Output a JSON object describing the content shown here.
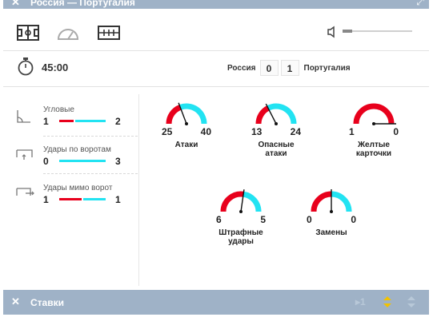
{
  "header": {
    "title": "Россия — Португалия",
    "close_icon": "close-icon",
    "expand_icon": "expand-icon"
  },
  "toolbar": {
    "icons": [
      "field-icon",
      "speedometer-icon",
      "scoreboard-icon"
    ],
    "volume_icon": "speaker-icon",
    "volume_level": 0.14
  },
  "match": {
    "time": "45:00",
    "team_a": "Россия",
    "team_b": "Португалия",
    "score_a": "0",
    "score_b": "1"
  },
  "colors": {
    "team_a": "#e8001c",
    "team_b": "#22e3f2",
    "header_bg": "#9fb2c7"
  },
  "side_stats": [
    {
      "label": "Угловые",
      "a": "1",
      "b": "2",
      "a_share": 0.33,
      "icon": "corner-flag-icon"
    },
    {
      "label": "Удары по воротам",
      "a": "0",
      "b": "3",
      "a_share": 0.0,
      "icon": "goal-target-icon"
    },
    {
      "label": "Удары мимо ворот",
      "a": "1",
      "b": "1",
      "a_share": 0.5,
      "icon": "goal-miss-icon"
    }
  ],
  "gauges": [
    {
      "label": "Атаки",
      "a": "25",
      "b": "40",
      "a_share": 0.385
    },
    {
      "label": "Опасные\nатаки",
      "a": "13",
      "b": "24",
      "a_share": 0.35
    },
    {
      "label": "Желтые\nкарточки",
      "a": "1",
      "b": "0",
      "a_share": 1.0
    },
    {
      "label": "Штрафные\nудары",
      "a": "6",
      "b": "5",
      "a_share": 0.545
    },
    {
      "label": "Замены",
      "a": "0",
      "b": "0",
      "a_share": 0.5
    }
  ],
  "bets": {
    "title": "Ставки",
    "count": "1"
  }
}
